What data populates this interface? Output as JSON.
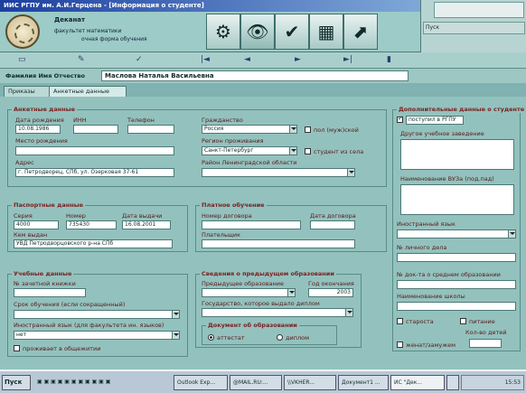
{
  "window_title": "ИИС РГПУ им. А.И.Герцена - [Информация о студенте]",
  "header": {
    "org": "Деканат",
    "faculty": "факультет математики",
    "form": "очная форма обучения"
  },
  "mini_window": {
    "start_label": "Пуск"
  },
  "nav": {
    "first": "|◄",
    "prev": "◄",
    "next": "►",
    "last": "►|"
  },
  "student": {
    "fio_label": "Фамилия Имя Отчество",
    "fio_value": "Маслова Наталья Васильевна"
  },
  "tabs": [
    {
      "label": "Приказы"
    },
    {
      "label": "Анкетные данные"
    }
  ],
  "anketa": {
    "title": "Анкетные данные",
    "dob_label": "Дата рождения",
    "dob": "10.08.1986",
    "inn_label": "ИНН",
    "inn": "",
    "phone_label": "Телефон",
    "phone": "",
    "birthplace_label": "Место рождения",
    "birthplace": "",
    "address_label": "Адрес",
    "address": "г. Петродворец, СПб, ул. Озерковая 37-61",
    "citizenship_label": "Гражданство",
    "citizenship": "Россия",
    "gender_label": "пол (муж)ской",
    "region_label": "Регион проживания",
    "region": "Санкт-Петербург",
    "village_label": "студент из села",
    "district_label": "Район Ленинградской области",
    "district": ""
  },
  "passport": {
    "title": "Паспортные данные",
    "series_label": "Серия",
    "series": "4000",
    "number_label": "Номер",
    "number": "735430",
    "date_label": "Дата выдачи",
    "date": "16.08.2001",
    "issuer_label": "Кем выдан",
    "issuer": "УВД Петродворцовского р-на СПб"
  },
  "paid": {
    "title": "Платное обучение",
    "contract_label": "Номер договора",
    "contract": "",
    "contract_date_label": "Дата договора",
    "contract_date": "",
    "payer_label": "Плательщик",
    "payer": ""
  },
  "study": {
    "title": "Учебные данные",
    "record_label": "№ зачетной книжки",
    "record": "",
    "term_label": "Срок обучения (если сокращенный)",
    "term": "",
    "lang_label": "Иностранный язык (для факультета ин. языков)",
    "lang": "нет",
    "dorm_label": "проживает в общежитии"
  },
  "prev_edu": {
    "title": "Сведения о предыдущем образовании",
    "prev_label": "Предыдущее образование",
    "prev": "",
    "year_label": "Год окончания",
    "year": "2003",
    "issuer_label": "Государство, которое выдало диплом",
    "issuer": "",
    "doc_label": "Документ об образовании",
    "att_label": "аттестат",
    "dip_label": "диплом"
  },
  "extra": {
    "title": "Дополнительные данные о студенте",
    "entered_label": "поступил в РГПУ",
    "other_label": "Другое учебное заведение",
    "vuz_label": "Наименование ВУЗа (под.пад)",
    "foreign_label": "Иностранный язык",
    "foreign": "",
    "personal_label": "№ личного дела",
    "personal": "",
    "secondary_label": "№ док-та о среднем образовании",
    "secondary": "",
    "school_label": "Наименование школы",
    "school": "",
    "head_label": "староста",
    "food_label": "питание",
    "children_label": "Кол-во детей",
    "married_label": "женат/замужем"
  },
  "taskbar": {
    "start": "Пуск",
    "items": [
      "Outlook Exp...",
      "@MAIL.RU:...",
      "\\\\VKHER...",
      "Документ1 ...",
      "ИС \"Дек...",
      "",
      ""
    ],
    "clock": "15:53"
  }
}
